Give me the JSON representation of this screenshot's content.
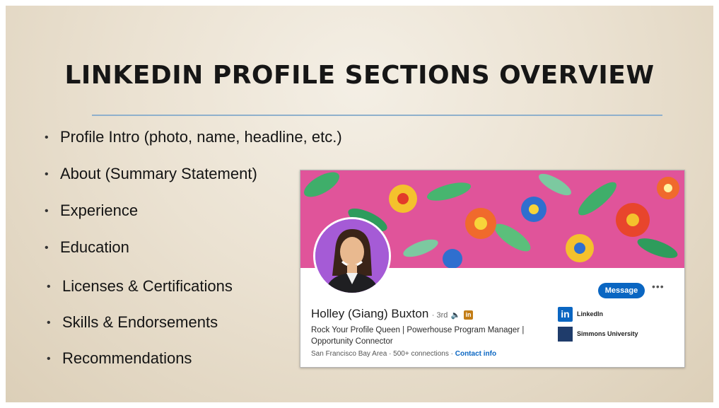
{
  "slide": {
    "title": "LINKEDIN PROFILE SECTIONS OVERVIEW",
    "bullets": [
      "Profile Intro (photo, name, headline, etc.)",
      "About (Summary Statement)",
      "Experience",
      "Education",
      "Licenses & Certifications",
      "Skills & Endorsements",
      "Recommendations"
    ]
  },
  "profile": {
    "name": "Holley (Giang) Buxton",
    "degree": "3rd",
    "headline": "Rock Your Profile Queen | Powerhouse Program Manager | Opportunity Connector",
    "location": "San Francisco Bay Area",
    "connections": "500+ connections",
    "contact_info": "Contact info",
    "message_button": "Message",
    "more_button": "•••",
    "orgs": [
      "LinkedIn",
      "Simmons University"
    ]
  },
  "colors": {
    "linkedin_blue": "#0a66c2",
    "banner_pink": "#e0549a",
    "avatar_purple": "#a55bd6",
    "rule_blue": "#8fb0cc"
  },
  "icons": [
    "bullet-icon",
    "speaker-icon",
    "linkedin-premium-icon",
    "linkedin-logo-icon",
    "simmons-logo-icon"
  ]
}
